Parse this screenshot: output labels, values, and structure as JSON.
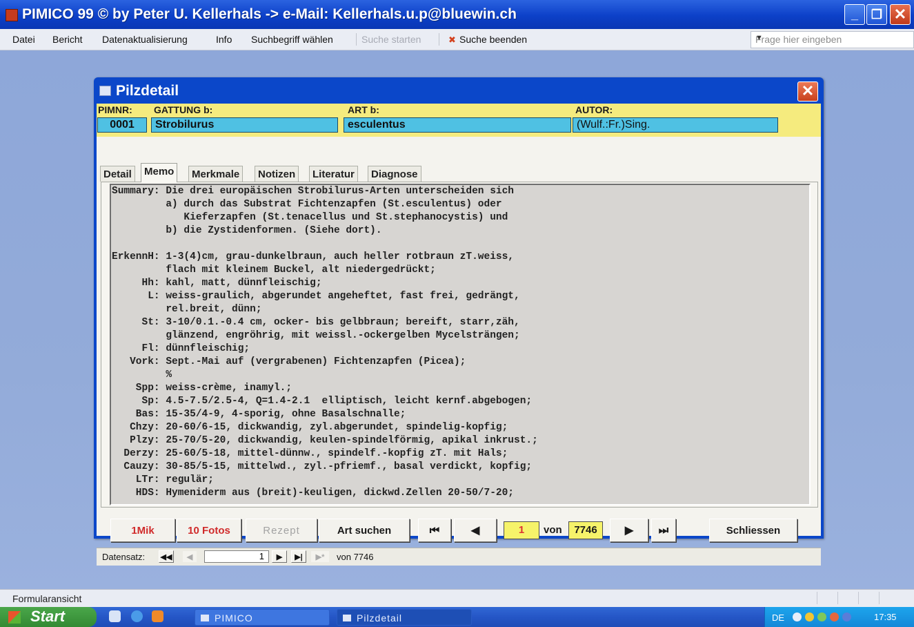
{
  "app": {
    "title": "PIMICO 99  © by Peter U. Kellerhals -> e-Mail: Kellerhals.u.p@bluewin.ch",
    "window_buttons": [
      "_",
      "❐",
      "✕"
    ]
  },
  "menu": {
    "items": [
      "Datei",
      "Bericht",
      "Datenaktualisierung",
      "Info",
      "Suchbegriff wählen",
      "Suche starten",
      "Suche beenden"
    ],
    "ask_placeholder": "Frage hier eingeben"
  },
  "form": {
    "title": "Pilzdetail",
    "close": "✕",
    "header": {
      "labels": [
        "PIMNR:",
        "GATTUNG b:",
        "ART b:",
        "AUTOR:"
      ],
      "pimnr": "0001",
      "gattung": "Strobilurus",
      "art": "esculentus",
      "autor": "(Wulf.:Fr.)Sing."
    },
    "tabs": [
      "Detail",
      "Memo",
      "Merkmale",
      "Notizen",
      "Literatur",
      "Diagnose"
    ],
    "active_tab": "Memo",
    "memo": "Summary: Die drei europäischen Strobilurus-Arten unterscheiden sich\n         a) durch das Substrat Fichtenzapfen (St.esculentus) oder\n            Kieferzapfen (St.tenacellus und St.stephanocystis) und\n         b) die Zystidenformen. (Siehe dort).\n\nErkennH: 1-3(4)cm, grau-dunkelbraun, auch heller rotbraun zT.weiss,\n         flach mit kleinem Buckel, alt niedergedrückt;\n     Hh: kahl, matt, dünnfleischig;\n      L: weiss-graulich, abgerundet angeheftet, fast frei, gedrängt,\n         rel.breit, dünn;\n     St: 3-10/0.1.-0.4 cm, ocker- bis gelbbraun; bereift, starr,zäh,\n         glänzend, engröhrig, mit weissl.-ockergelben Mycelsträngen;\n     Fl: dünnfleischig;\n   Vork: Sept.-Mai auf (vergrabenen) Fichtenzapfen (Picea);\n         %\n    Spp: weiss-crème, inamyl.;\n     Sp: 4.5-7.5/2.5-4, Q=1.4-2.1  elliptisch, leicht kernf.abgebogen;\n    Bas: 15-35/4-9, 4-sporig, ohne Basalschnalle;\n   Chzy: 20-60/6-15, dickwandig, zyl.abgerundet, spindelig-kopfig;\n   Plzy: 25-70/5-20, dickwandig, keulen-spindelförmig, apikal inkrust.;\n  Derzy: 25-60/5-18, mittel-dünnw., spindelf.-kopfig zT. mit Hals;\n  Cauzy: 30-85/5-15, mittelwd., zyl.-pfriemf., basal verdickt, kopfig;\n    LTr: regulär;\n    HDS: Hymeniderm aus (breit)-keuligen, dickwd.Zellen 20-50/7-20;",
    "buttons": {
      "mik": "1Mik",
      "fotos": "10 Fotos",
      "rezept": "Rezept",
      "art_suchen": "Art suchen",
      "first": "⏮",
      "prev": "◀",
      "next": "▶",
      "last": "⏭",
      "schliessen": "Schliessen"
    },
    "record": {
      "current": "1",
      "of_label": "von",
      "total": "7746"
    },
    "navigator": {
      "label": "Datensatz:",
      "first": "◀◀",
      "prev": "◀",
      "position": "1",
      "next": "▶",
      "last": "▶|",
      "new": "▶*",
      "total_text": "von 7746"
    }
  },
  "statusbar": {
    "text": "Formularansicht"
  },
  "taskbar": {
    "start": "Start",
    "tasks": [
      "PIMICO",
      "Pilzdetail"
    ],
    "lang": "DE",
    "clock": "17:35"
  }
}
